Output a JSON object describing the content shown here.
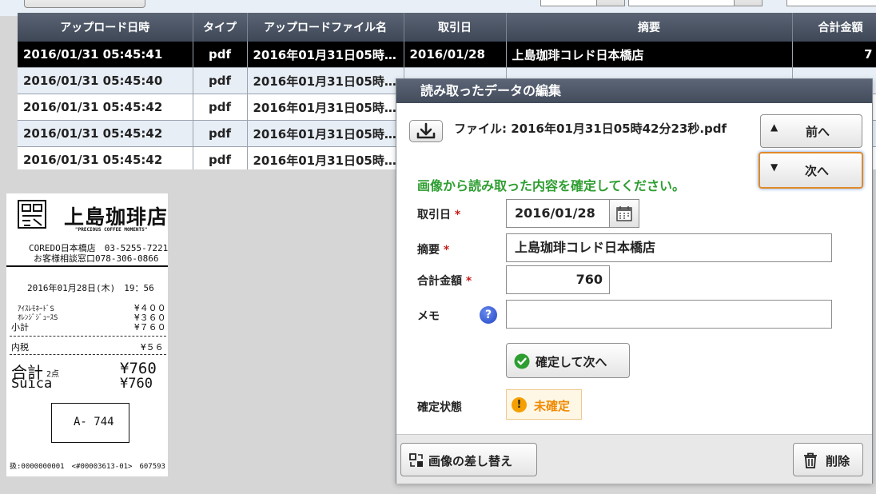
{
  "table": {
    "headers": [
      "アップロード日時",
      "タイプ",
      "アップロードファイル名",
      "取引日",
      "摘要",
      "合計金額"
    ],
    "rows": [
      [
        "2016/01/31 05:45:41",
        "pdf",
        "2016年01月31日05時…",
        "2016/01/28",
        "上島珈琲コレド日本橋店",
        "7"
      ],
      [
        "2016/01/31 05:45:40",
        "pdf",
        "2016年01月31日05時…",
        "",
        "",
        ""
      ],
      [
        "2016/01/31 05:45:42",
        "pdf",
        "2016年01月31日05時…",
        "",
        "",
        ""
      ],
      [
        "2016/01/31 05:45:42",
        "pdf",
        "2016年01月31日05時…",
        "",
        "",
        ""
      ],
      [
        "2016/01/31 05:45:42",
        "pdf",
        "2016年01月31日05時…",
        "",
        "",
        ""
      ]
    ]
  },
  "receipt": {
    "shop_logo": "上島珈琲店",
    "tagline": "\"PRECIOUS COFFEE MOMENTS\"",
    "store_line": "COREDO日本橋店　03-5255-7221",
    "contact_line": "お客様相談窓口078-306-0866",
    "date_line": "2016年01月28日(木)　19：56",
    "items": [
      {
        "name": "ｱｲｽﾚﾓﾈｰﾄﾞS",
        "price": "¥４００"
      },
      {
        "name": "ｵﾚﾝｼﾞｼﾞｭｰｽS",
        "price": "¥３６０"
      },
      {
        "name": "小計",
        "price": "¥７６０"
      }
    ],
    "tax_label": "内税",
    "tax_value": "¥５６",
    "total_label": "合計",
    "total_count": "2点",
    "total_value": "¥760",
    "payment_label": "Suica",
    "payment_value": "¥760",
    "box_code": "A- 744",
    "footer_line": "扱:0000000001　<#00003613-01>　607593"
  },
  "dialog": {
    "title": "読み取ったデータの編集",
    "file_label": "ファイル: 2016年01月31日05時42分23秒.pdf",
    "prev_label": "前へ",
    "next_label": "次へ",
    "instruction": "画像から読み取った内容を確定してください。",
    "date_label": "取引日",
    "date_value": "2016/01/28",
    "desc_label": "摘要",
    "desc_value": "上島珈琲コレド日本橋店",
    "amount_label": "合計金額",
    "amount_value": "760",
    "memo_label": "メモ",
    "memo_value": "",
    "confirm_label": "確定して次へ",
    "status_label": "確定状態",
    "status_value": "未確定",
    "replace_label": "画像の差し替え",
    "delete_label": "削除",
    "required_mark": "*",
    "help_glyph": "?",
    "colors": {
      "accent_green": "#2e9e31",
      "status_orange": "#f08a00",
      "required_red": "#c51d1d",
      "header_dark": "#4a5363"
    }
  }
}
